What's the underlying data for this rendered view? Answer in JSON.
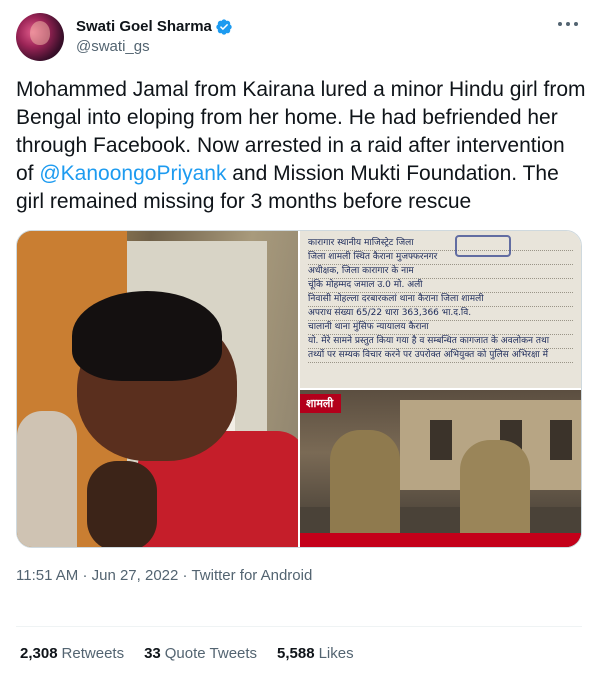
{
  "author": {
    "display_name": "Swati Goel Sharma",
    "handle": "@swati_gs",
    "verified": true
  },
  "tweet": {
    "text_before": "Mohammed Jamal from Kairana lured a minor Hindu girl from Bengal into eloping from her home. He had befriended her through Facebook. Now arrested in a raid after intervention of ",
    "mention": "@KanoongoPriyank",
    "text_after": " and Mission Mukti Foundation. The girl remained missing for 3 months before rescue"
  },
  "media": {
    "doc_lines": [
      "कारागार स्थानीय माजिस्ट्रेट     जिला",
      "जिला  शामली स्थित कैराना      मुजफ्फरनगर",
      "अधीक्षक, जिला कारागार                      के नाम",
      "चूंकि  मोहम्मद जमाल उ.0 मो. अली",
      "निवासी मोहल्ला दरबारकलां थाना कैराना जिला शामली",
      "अपराध संख्या  65/22      धारा 363,366 भा.द.वि.",
      "चालानी थाना     मुंसिफ न्यायालय कैराना",
      "यो. मेरे सामने प्रस्तुत किया गया है व सम्बन्धित कागजात के अवलोकन तथा",
      "तथ्यों पर सम्यक विचार करने पर उपरोक्त अभियुक्त को पुलिस अभिरक्षा में"
    ],
    "scene_tag": "शामली"
  },
  "meta": {
    "time": "11:51 AM",
    "separator": "·",
    "date": "Jun 27, 2022",
    "source": "Twitter for Android"
  },
  "stats": {
    "retweets_count": "2,308",
    "retweets_label": "Retweets",
    "quotes_count": "33",
    "quotes_label": "Quote Tweets",
    "likes_count": "5,588",
    "likes_label": "Likes"
  },
  "colors": {
    "link": "#1d9bf0",
    "text": "#0f1419",
    "secondary": "#536471",
    "verified": "#1d9bf0",
    "news_tag": "#b3001b"
  },
  "icons": {
    "verified": "verified-badge-icon",
    "more": "more-options-icon"
  }
}
